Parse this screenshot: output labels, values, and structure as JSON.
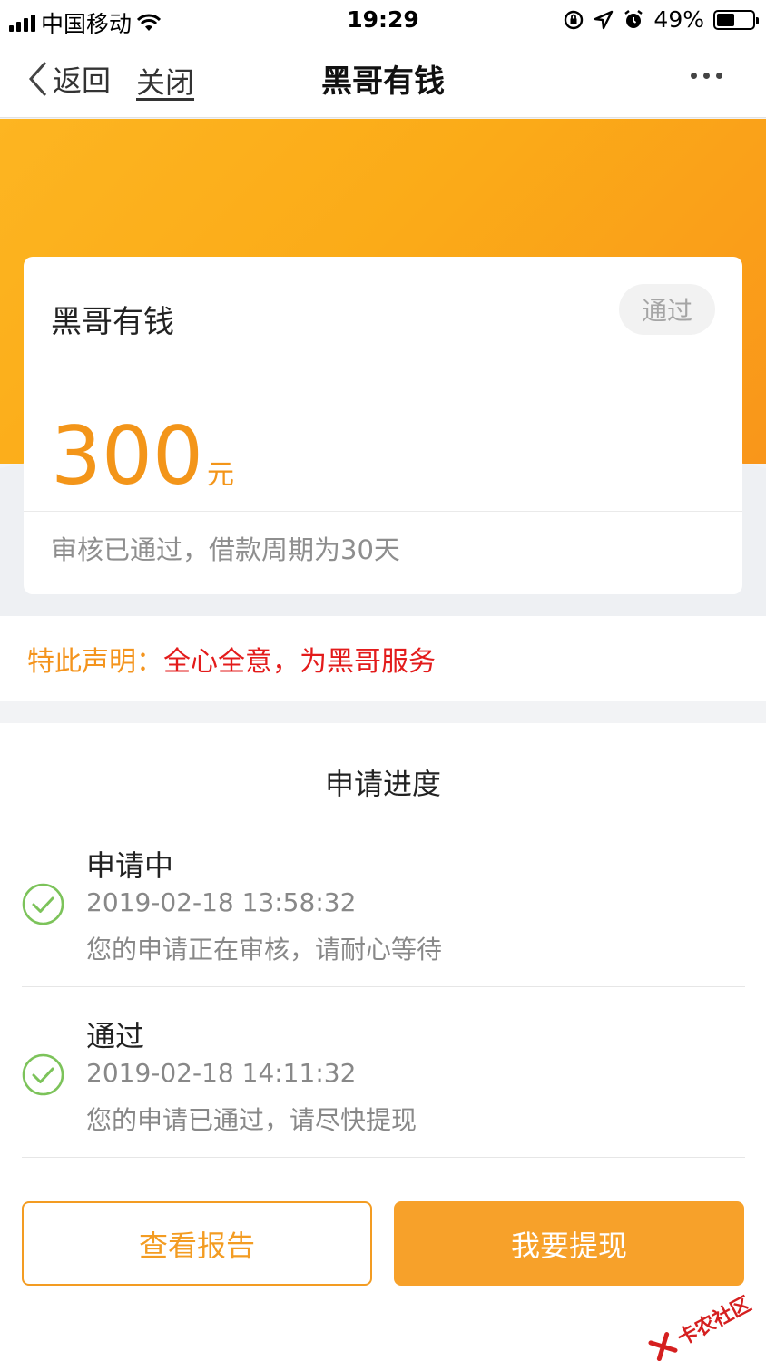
{
  "status_bar": {
    "carrier": "中国移动",
    "time": "19:29",
    "battery": "49%"
  },
  "nav": {
    "back": "返回",
    "close": "关闭",
    "title": "黑哥有钱"
  },
  "card": {
    "title": "黑哥有钱",
    "badge": "通过",
    "amount": "300",
    "unit": "元",
    "note": "审核已通过，借款周期为30天"
  },
  "statement": {
    "label": "特此声明：",
    "text": "全心全意，为黑哥服务"
  },
  "progress": {
    "title": "申请进度",
    "steps": [
      {
        "title": "申请中",
        "time": "2019-02-18 13:58:32",
        "desc": "您的申请正在审核，请耐心等待"
      },
      {
        "title": "通过",
        "time": "2019-02-18 14:11:32",
        "desc": "您的申请已通过，请尽快提现"
      }
    ]
  },
  "buttons": {
    "report": "查看报告",
    "withdraw": "我要提现"
  },
  "watermark": "卡农社区",
  "colors": {
    "accent": "#f39519",
    "statement_red": "#e31b1b",
    "check_green": "#7cc35a"
  }
}
